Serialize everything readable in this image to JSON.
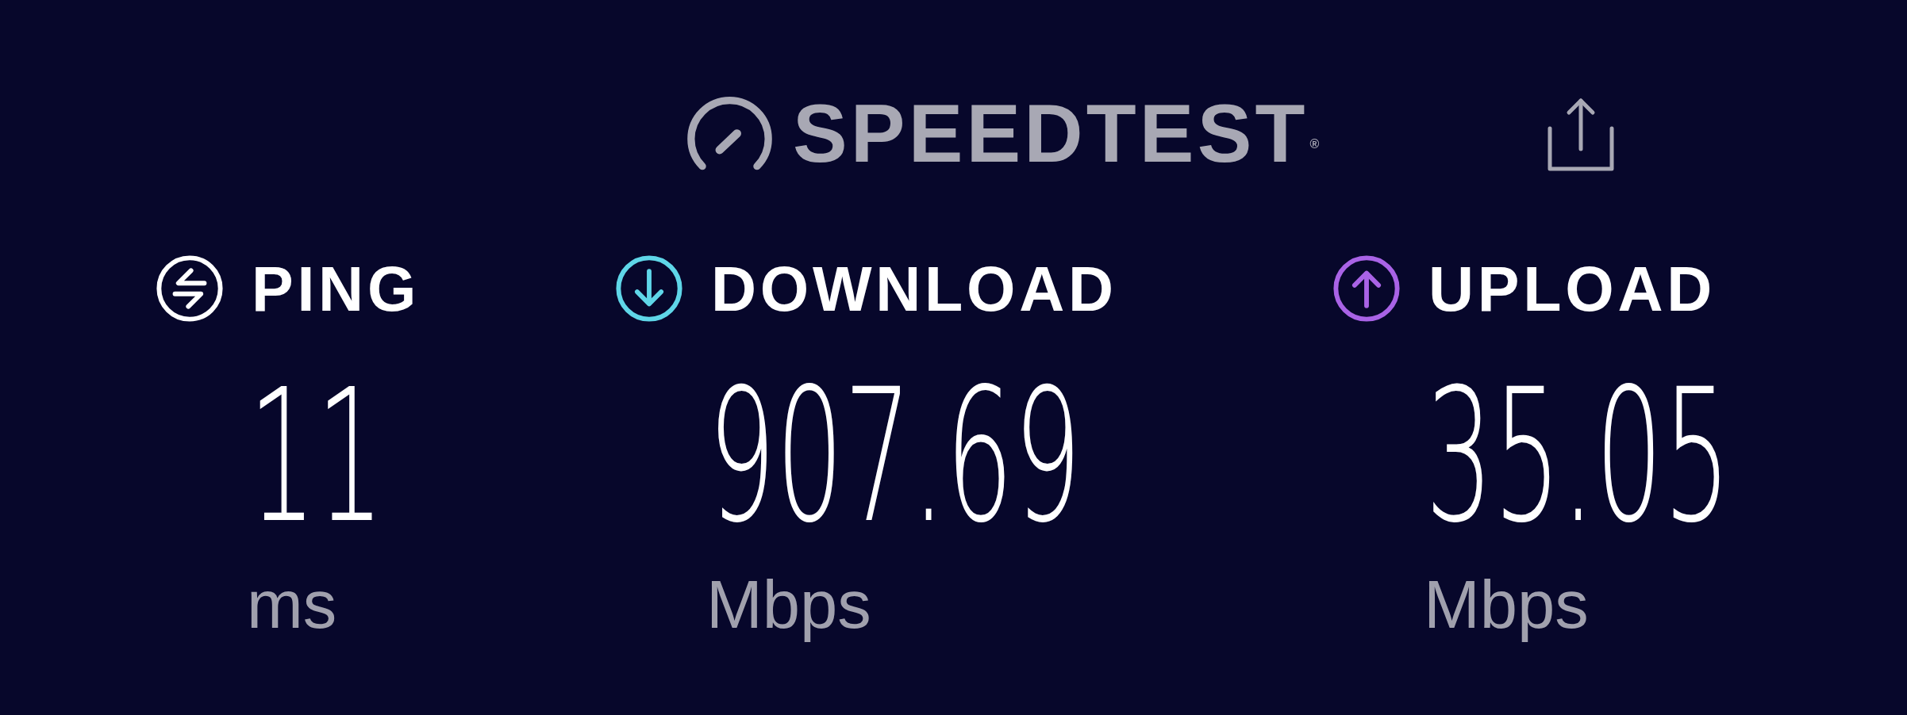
{
  "logo": {
    "text": "SPEEDTEST$^{®}$"
  },
  "metrics": [
    {
      "kind": "ping",
      "label": "PING",
      "color": "#ffffff",
      "value": "11",
      "unit": "ms"
    },
    {
      "kind": "download",
      "label": "DOWNLOAD",
      "color": "#5fd6e8",
      "value": "907.69",
      "unit": "Mbps"
    },
    {
      "kind": "upload",
      "label": "UPLOAD",
      "color": "#a963e6",
      "value": "35.05",
      "unit": "Mbps"
    }
  ]
}
